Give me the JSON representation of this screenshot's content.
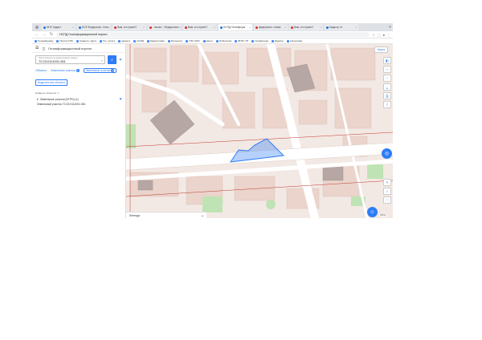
{
  "browser": {
    "tabs": [
      {
        "label": "ФНС Кадаст"
      },
      {
        "label": "НСЕ Федеральн. Спис."
      },
      {
        "label": "Вам, кто нужен?",
        "red": true
      },
      {
        "label": "- значит - Федерально",
        "red": true
      },
      {
        "label": "Вам, кто нужен?",
        "red": true
      },
      {
        "label": "НСПД Геоинформ.",
        "active": true
      },
      {
        "label": "федеральн. схема",
        "red": true
      },
      {
        "label": "Вам, кто нужен?",
        "red": true
      },
      {
        "label": "Кадастр от"
      }
    ],
    "address": "НСПД Геоинформационный портал",
    "bookmarks": [
      "Геоинформац",
      "Портал ГИС",
      "Кадастр. карта",
      "Гос. услуги",
      "кадастр",
      "НСПД",
      "Кадастровая",
      "Росреестр",
      "ГИС ЖКХ",
      "Налог",
      "Публичная",
      "ФГИС ТП",
      "Справочник",
      "Кадастр",
      "Налоговая"
    ]
  },
  "panel": {
    "title": "Геоинформационный портал",
    "search_hint": "Поиск объекта по кадастровому номеру",
    "search_value": "72:23:0111001:351",
    "tabs": [
      {
        "label": "Объекты"
      },
      {
        "label": "Земельные участки",
        "count": "1"
      },
      {
        "label": "Земельные участки",
        "count": "1",
        "selected": true
      }
    ],
    "select_all": "Выделить все объекты",
    "found": "Найдено объектов: 1",
    "group_label": "Земельные участки (ЕГРН) (1)",
    "parcel": "Земельный участок 72:23:0111001:351"
  },
  "map": {
    "basemap": "Карта",
    "legend": "Легенда",
    "scale": "100 м",
    "colors": {
      "background": "#f3e9e4",
      "building": "#ead4cc",
      "building_dark": "#b7a7a4",
      "road": "#ffffff",
      "green": "#bfe3b4",
      "highlight": "#2e7cf6",
      "boundary": "#c0392b"
    }
  }
}
